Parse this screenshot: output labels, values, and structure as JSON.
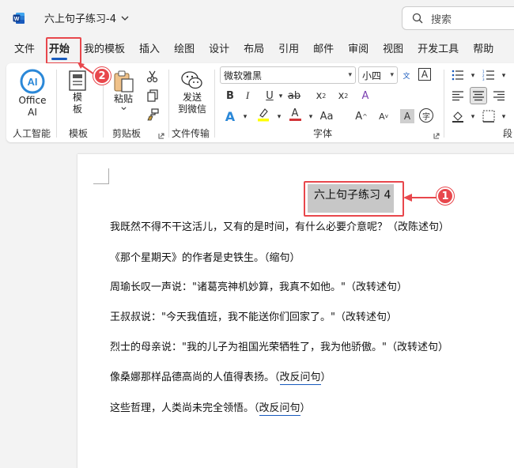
{
  "window": {
    "title": "六上句子练习-4",
    "search_placeholder": "搜索"
  },
  "tabs": [
    "文件",
    "开始",
    "我的模板",
    "插入",
    "绘图",
    "设计",
    "布局",
    "引用",
    "邮件",
    "审阅",
    "视图",
    "开发工具",
    "帮助"
  ],
  "ribbon": {
    "ai_button": "Office AI",
    "ai_button_line1": "Office",
    "ai_button_line2": "AI",
    "template_line1": "模",
    "template_line2": "板",
    "paste_label": "粘贴",
    "send_line1": "发送",
    "send_line2": "到微信",
    "font_name": "微软雅黑",
    "font_size": "小四",
    "groups": {
      "ai": "人工智能",
      "template": "模板",
      "clipboard": "剪贴板",
      "file_transfer": "文件传输",
      "font": "字体",
      "paragraph": "段"
    }
  },
  "callouts": {
    "one": "1",
    "two": "2"
  },
  "document": {
    "heading": "六上句子练习 4",
    "paragraphs": [
      "我既然不得不干这活儿，又有的是时间，有什么必要介意呢？（改陈述句）",
      "《那个星期天》的作者是史铁生。（缩句）",
      "周瑜长叹一声说：\"诸葛亮神机妙算，我真不如他。\"（改转述句）",
      "王叔叔说：\"今天我值班，我不能送你们回家了。\"（改转述句）",
      "烈士的母亲说：\"我的儿子为祖国光荣牺牲了，我为他骄傲。\"（改转述句）"
    ],
    "para6_text": "像桑娜那样品德高尚的人值得表扬。（",
    "para6_underlined": "改反问句",
    "para6_close": "）",
    "para7_text": "这些哲理，人类尚未完全领悟。（",
    "para7_underlined": "改反问句",
    "para7_close": "）"
  },
  "colors": {
    "accent": "#185abd",
    "callout": "#e8474c",
    "font_color_bar": "#d13438",
    "highlight_bar": "#ffff00"
  }
}
